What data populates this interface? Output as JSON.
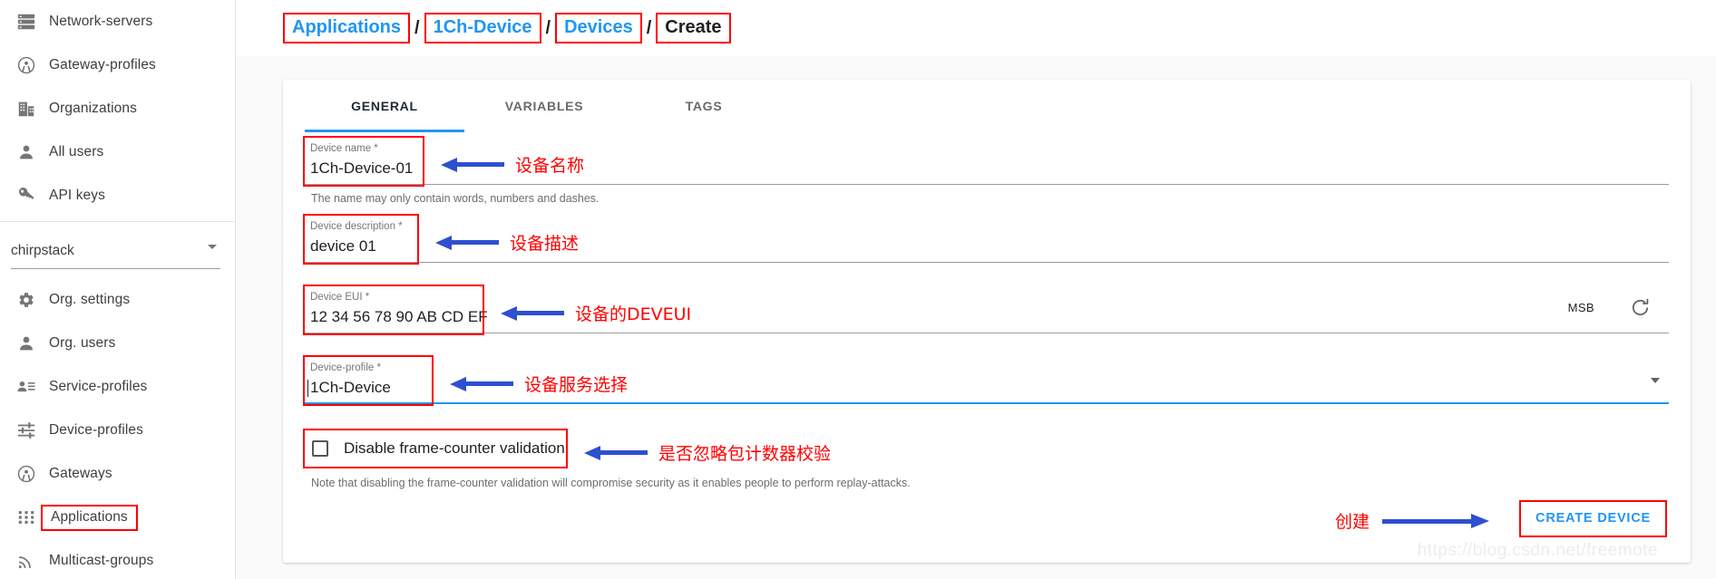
{
  "sidebar": {
    "items_top": [
      {
        "label": "Network-servers",
        "icon": "server-icon",
        "boxed": false
      },
      {
        "label": "Gateway-profiles",
        "icon": "antenna-icon",
        "boxed": false
      },
      {
        "label": "Organizations",
        "icon": "building-icon",
        "boxed": false
      },
      {
        "label": "All users",
        "icon": "person-icon",
        "boxed": false
      },
      {
        "label": "API keys",
        "icon": "key-icon",
        "boxed": false
      }
    ],
    "org_selector": {
      "value": "chirpstack"
    },
    "items_bottom": [
      {
        "label": "Org. settings",
        "icon": "gear-icon",
        "boxed": false
      },
      {
        "label": "Org. users",
        "icon": "person-icon",
        "boxed": false
      },
      {
        "label": "Service-profiles",
        "icon": "person-list-icon",
        "boxed": false
      },
      {
        "label": "Device-profiles",
        "icon": "sliders-icon",
        "boxed": false
      },
      {
        "label": "Gateways",
        "icon": "antenna-icon",
        "boxed": false
      },
      {
        "label": "Applications",
        "icon": "grid-icon",
        "boxed": true
      },
      {
        "label": "Multicast-groups",
        "icon": "broadcast-icon",
        "boxed": false
      }
    ]
  },
  "breadcrumb": {
    "separator": "/",
    "items": [
      {
        "label": "Applications",
        "link": true
      },
      {
        "label": "1Ch-Device",
        "link": true
      },
      {
        "label": "Devices",
        "link": true
      },
      {
        "label": "Create",
        "link": false
      }
    ]
  },
  "tabs": [
    {
      "label": "GENERAL",
      "active": true
    },
    {
      "label": "VARIABLES",
      "active": false
    },
    {
      "label": "TAGS",
      "active": false
    }
  ],
  "form": {
    "device_name": {
      "label": "Device name *",
      "value": "1Ch-Device-01",
      "hint": "The name may only contain words, numbers and dashes.",
      "annotation": "设备名称"
    },
    "device_description": {
      "label": "Device description *",
      "value": "device 01",
      "annotation": "设备描述"
    },
    "device_eui": {
      "label": "Device EUI *",
      "value": "12 34 56 78 90 AB CD EF",
      "adornment": "MSB",
      "refresh_icon": "refresh-icon",
      "annotation": "设备的DEVEUI"
    },
    "device_profile": {
      "label": "Device-profile *",
      "value": "1Ch-Device",
      "annotation": "设备服务选择"
    },
    "disable_frame_counter": {
      "label": "Disable frame-counter validation",
      "checked": false,
      "hint": "Note that disabling the frame-counter validation will compromise security as it enables people to perform replay-attacks.",
      "annotation": "是否忽略包计数器校验"
    }
  },
  "actions": {
    "create_label": "CREATE DEVICE",
    "create_annotation": "创建"
  },
  "watermark": "https://blog.csdn.net/freemote",
  "colors": {
    "accent": "#2196f3",
    "highlight": "#ff0000",
    "arrow": "#2e4fd0",
    "text": "#202124"
  }
}
